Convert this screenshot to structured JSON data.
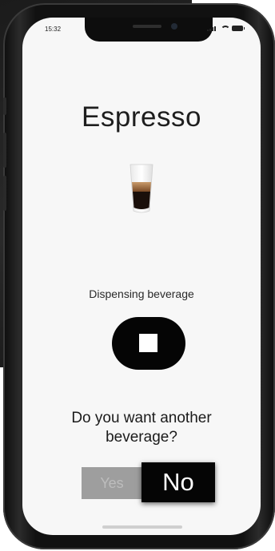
{
  "status_bar": {
    "time": "15:32"
  },
  "beverage": {
    "title": "Espresso",
    "icon": "espresso-glass-icon"
  },
  "dispense": {
    "status": "Dispensing beverage",
    "stop_icon": "stop-icon"
  },
  "prompt": {
    "question": "Do you want another beverage?",
    "yes_label": "Yes",
    "no_label": "No"
  },
  "colors": {
    "background": "#f7f7f7",
    "button_dark": "#050505",
    "button_disabled": "#9e9e9e",
    "text": "#1e1e1e"
  }
}
